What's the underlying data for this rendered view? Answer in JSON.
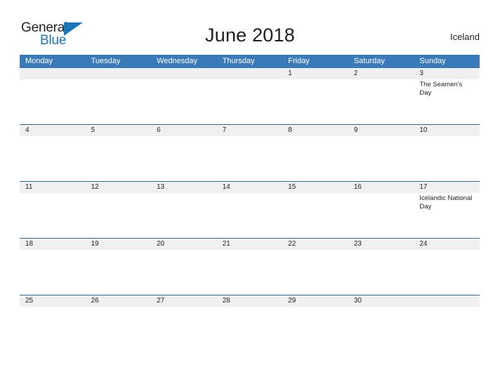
{
  "brand": {
    "name_part1": "General",
    "name_part2": "Blue",
    "flag_icon": "blue-triangle-flag",
    "colors": {
      "dark": "#231f20",
      "blue": "#1b75bb"
    }
  },
  "header": {
    "title": "June 2018",
    "country": "Iceland"
  },
  "theme": {
    "header_blue": "#3a7ab8",
    "row_border_blue": "#2e6da4",
    "day_band_gray": "#f0f0f0",
    "text": "#231f20",
    "header_text": "#ffffff"
  },
  "calendar": {
    "weekdays": [
      "Monday",
      "Tuesday",
      "Wednesday",
      "Thursday",
      "Friday",
      "Saturday",
      "Sunday"
    ],
    "weeks": [
      [
        {
          "day": "",
          "events": []
        },
        {
          "day": "",
          "events": []
        },
        {
          "day": "",
          "events": []
        },
        {
          "day": "",
          "events": []
        },
        {
          "day": "1",
          "events": []
        },
        {
          "day": "2",
          "events": []
        },
        {
          "day": "3",
          "events": [
            "The Seamen's Day"
          ]
        }
      ],
      [
        {
          "day": "4",
          "events": []
        },
        {
          "day": "5",
          "events": []
        },
        {
          "day": "6",
          "events": []
        },
        {
          "day": "7",
          "events": []
        },
        {
          "day": "8",
          "events": []
        },
        {
          "day": "9",
          "events": []
        },
        {
          "day": "10",
          "events": []
        }
      ],
      [
        {
          "day": "11",
          "events": []
        },
        {
          "day": "12",
          "events": []
        },
        {
          "day": "13",
          "events": []
        },
        {
          "day": "14",
          "events": []
        },
        {
          "day": "15",
          "events": []
        },
        {
          "day": "16",
          "events": []
        },
        {
          "day": "17",
          "events": [
            "Icelandic National Day"
          ]
        }
      ],
      [
        {
          "day": "18",
          "events": []
        },
        {
          "day": "19",
          "events": []
        },
        {
          "day": "20",
          "events": []
        },
        {
          "day": "21",
          "events": []
        },
        {
          "day": "22",
          "events": []
        },
        {
          "day": "23",
          "events": []
        },
        {
          "day": "24",
          "events": []
        }
      ],
      [
        {
          "day": "25",
          "events": []
        },
        {
          "day": "26",
          "events": []
        },
        {
          "day": "27",
          "events": []
        },
        {
          "day": "28",
          "events": []
        },
        {
          "day": "29",
          "events": []
        },
        {
          "day": "30",
          "events": []
        },
        {
          "day": "",
          "events": []
        }
      ]
    ]
  }
}
